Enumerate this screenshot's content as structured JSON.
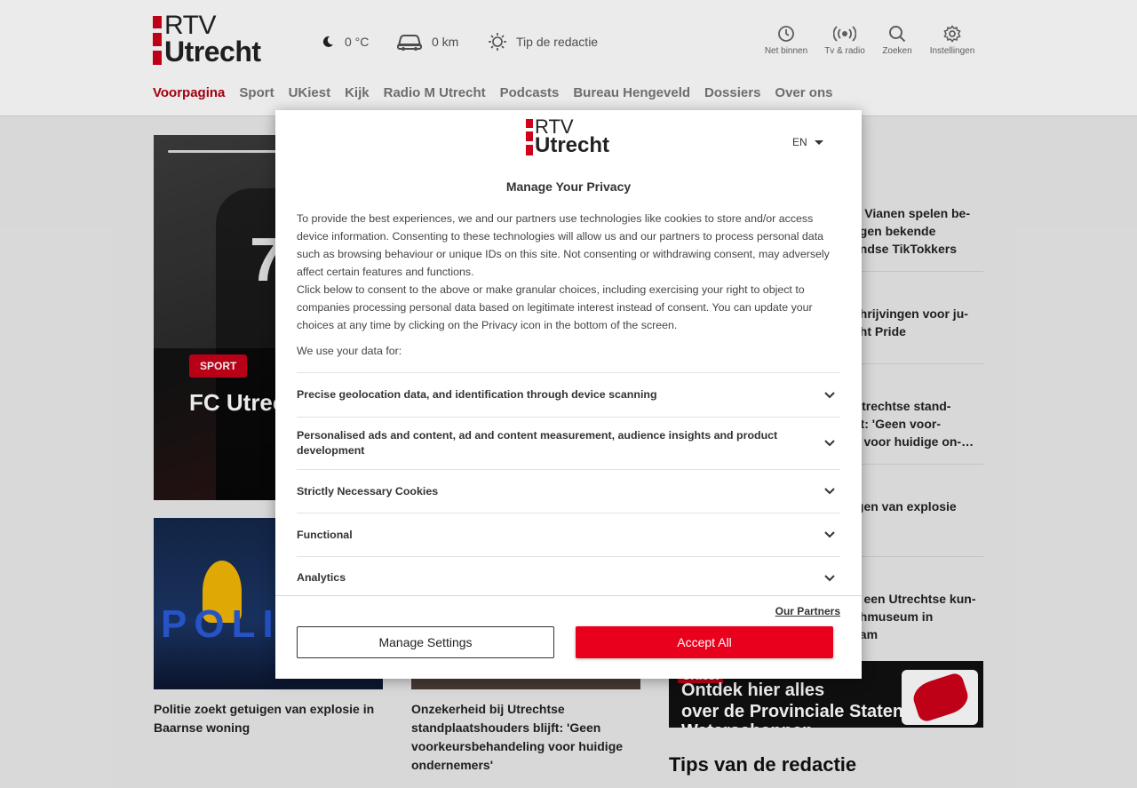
{
  "header": {
    "logo_line1": "RTV",
    "logo_line2": "Utrecht",
    "weather": "0 °C",
    "traffic": "0 km",
    "tip": "Tip de redactie",
    "utilities": [
      {
        "label": "Net binnen",
        "icon": "clock-icon"
      },
      {
        "label": "Tv & radio",
        "icon": "broadcast-icon"
      },
      {
        "label": "Zoeken",
        "icon": "search-icon"
      },
      {
        "label": "Instellingen",
        "icon": "gear-icon"
      }
    ],
    "nav": [
      "Voorpagina",
      "Sport",
      "UKiest",
      "Kijk",
      "Radio M Utrecht",
      "Podcasts",
      "Bureau Hengeveld",
      "Dossiers",
      "Over ons"
    ]
  },
  "hero": {
    "tag": "SPORT",
    "title": "FC Utrecht verhit du invalbeu"
  },
  "cards": [
    {
      "caption": "Politie zoekt getuigen van explosie in Baarnse woning"
    },
    {
      "caption": "Onzekerheid bij Utrechtse standplaatshouders blijft: 'Geen voorkeursbehandeling voor huidige ondernemers'"
    }
  ],
  "list": [
    "V Vianen spelen be-\negen bekende\nandse TikTokkers",
    "chrijvingen voor ju-\ncht Pride",
    "Utrechtse stand-\njft: 'Geen voor-\ng voor huidige on-…",
    "igen van explosie\ng",
    "n een Utrechtse kun-\nchmuseum in\nvam"
  ],
  "banner": {
    "badge": "UKiest",
    "line1": "Ontdek hier alles",
    "line2": "over de Provinciale Staten & Waterschappen"
  },
  "tips_heading": "Tips van de redactie",
  "modal": {
    "logo_line1": "RTV",
    "logo_line2": "Utrecht",
    "language": "EN",
    "title": "Manage Your Privacy",
    "body_p1": "To provide the best experiences, we and our partners use technologies like cookies to store and/or access device information. Consenting to these technologies will allow us and our partners to process personal data such as browsing behaviour or unique IDs on this site. Not consenting or withdrawing consent, may adversely affect certain features and functions.",
    "body_p2": "Click below to consent to the above or make granular choices, including exercising your right to object to companies processing personal data based on legitimate interest instead of consent. You can update your choices at any time by clicking on the Privacy icon in the bottom of the screen.",
    "use_intro": "We use your data for:",
    "purposes": [
      "Precise geolocation data, and identification through device scanning",
      "Personalised ads and content, ad and content measurement, audience insights and product development",
      "Strictly Necessary Cookies",
      "Functional",
      "Analytics"
    ],
    "partners_link": "Our Partners",
    "manage_button": "Manage Settings",
    "accept_button": "Accept All"
  },
  "colors": {
    "brand_red": "#d0021b",
    "accept_red": "#e8001c",
    "nav_active": "#b00012"
  }
}
